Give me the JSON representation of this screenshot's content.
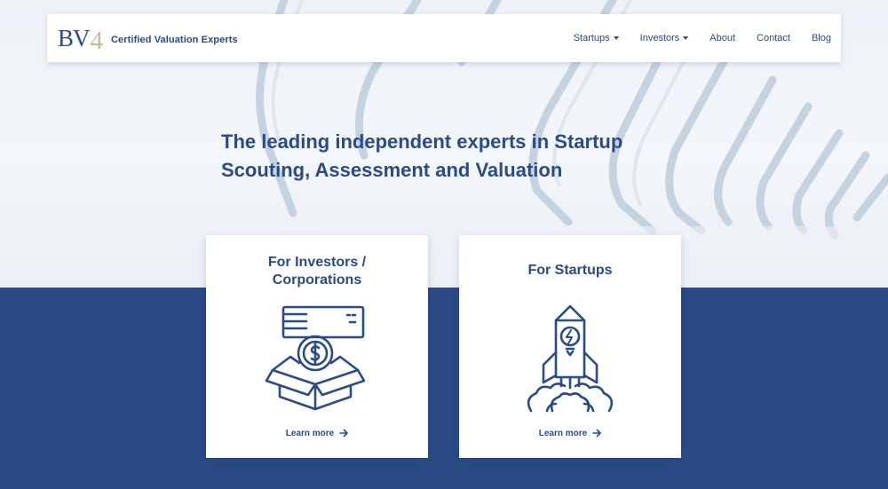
{
  "brand": {
    "mark": "BV",
    "mark_accent": "4",
    "tagline": "Certified Valuation Experts"
  },
  "nav": {
    "items": [
      {
        "label": "Startups",
        "dropdown": true
      },
      {
        "label": "Investors",
        "dropdown": true
      },
      {
        "label": "About",
        "dropdown": false
      },
      {
        "label": "Contact",
        "dropdown": false
      },
      {
        "label": "Blog",
        "dropdown": false
      }
    ]
  },
  "hero": {
    "headline_line1": "The leading independent experts in Startup",
    "headline_line2": "Scouting, Assessment and Valuation"
  },
  "cards": [
    {
      "title_line1": "For Investors /",
      "title_line2": "Corporations",
      "link": "Learn more",
      "icon": "money-box-icon"
    },
    {
      "title_line1": "For Startups",
      "title_line2": "",
      "link": "Learn more",
      "icon": "rocket-icon"
    }
  ],
  "colors": {
    "primary": "#2b4a86",
    "accent": "#c9b99a",
    "band": "#2b4a86"
  }
}
